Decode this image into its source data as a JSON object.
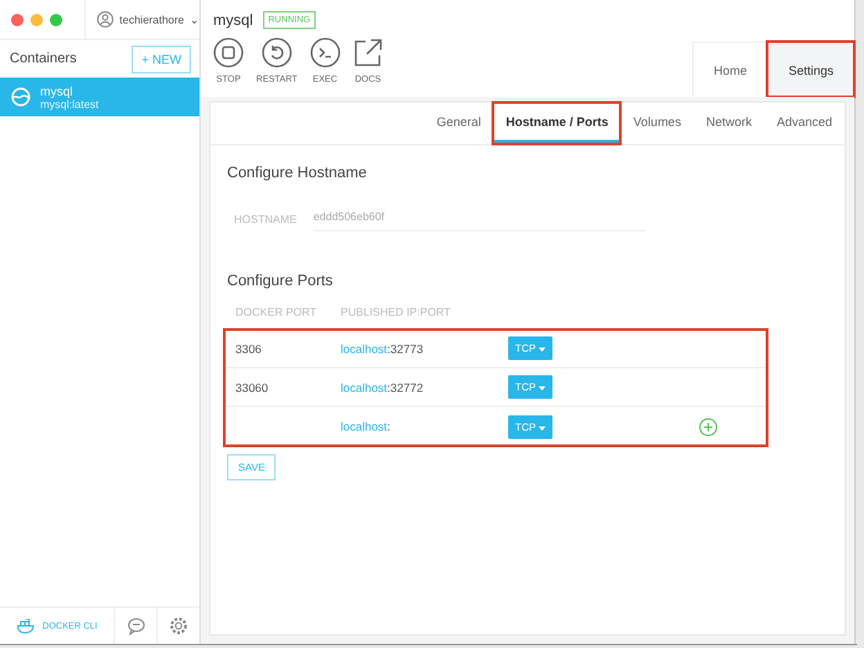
{
  "user": {
    "name": "techierathore",
    "caret": "⌄"
  },
  "sidebar": {
    "title": "Containers",
    "new_button": "+ NEW",
    "items": [
      {
        "name": "mysql",
        "image": "mysql:latest",
        "selected": true
      }
    ],
    "footer": {
      "cli": "DOCKER CLI"
    }
  },
  "header": {
    "container": "mysql",
    "status": "RUNNING",
    "actions": [
      {
        "kind": "stop",
        "label": "STOP"
      },
      {
        "kind": "restart",
        "label": "RESTART"
      },
      {
        "kind": "exec",
        "label": "EXEC"
      },
      {
        "kind": "docs",
        "label": "DOCS"
      }
    ]
  },
  "main_tabs": [
    {
      "label": "Home",
      "selected": false,
      "highlighted": false
    },
    {
      "label": "Settings",
      "selected": true,
      "highlighted": true
    }
  ],
  "sub_tabs": [
    {
      "label": "General",
      "selected": false,
      "highlighted": false
    },
    {
      "label": "Hostname / Ports",
      "selected": true,
      "highlighted": true
    },
    {
      "label": "Volumes",
      "selected": false,
      "highlighted": false
    },
    {
      "label": "Network",
      "selected": false,
      "highlighted": false
    },
    {
      "label": "Advanced",
      "selected": false,
      "highlighted": false
    }
  ],
  "hostname": {
    "title": "Configure Hostname",
    "label": "HOSTNAME",
    "value": "eddd506eb60f"
  },
  "ports": {
    "title": "Configure Ports",
    "highlighted": true,
    "columns": [
      "DOCKER PORT",
      "PUBLISHED IP:PORT"
    ],
    "rows": [
      {
        "docker_port": "3306",
        "host": "localhost",
        "port": ":32773",
        "protocol": "TCP",
        "can_add": false
      },
      {
        "docker_port": "33060",
        "host": "localhost",
        "port": ":32772",
        "protocol": "TCP",
        "can_add": false
      },
      {
        "docker_port": "",
        "host": "localhost",
        "port": ":",
        "protocol": "TCP",
        "can_add": true
      }
    ],
    "save": "SAVE"
  }
}
